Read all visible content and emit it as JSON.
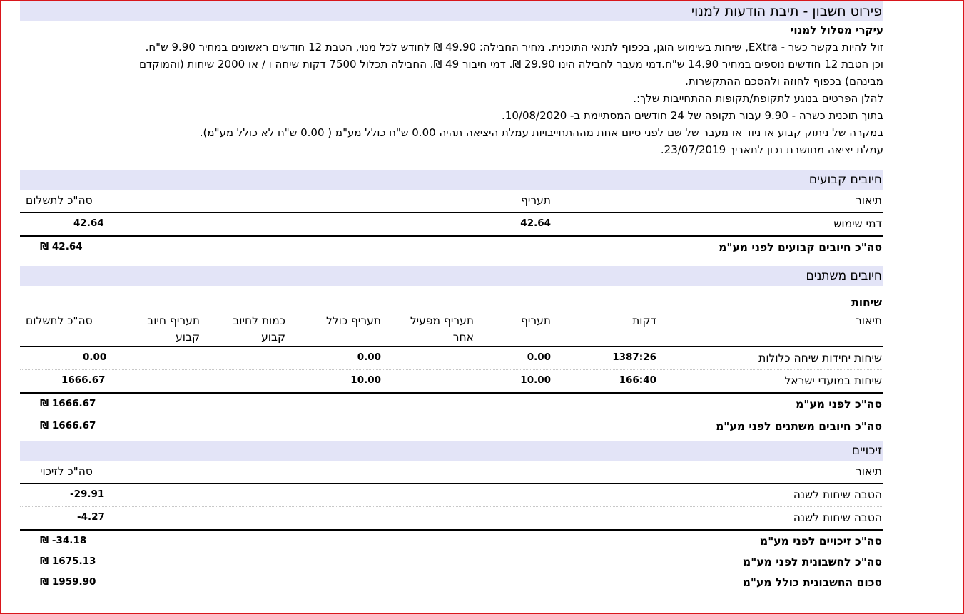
{
  "title": "פירוט חשבון - תיבת הודעות למנוי",
  "plan": {
    "heading": "עיקרי מסלול למנוי",
    "lines": [
      "זול להיות בקשר כשר - EXtra, שיחות בשימוש הוגן, בכפוף לתנאי התוכנית. מחיר החבילה: 49.90 ₪ לחודש לכל מנוי, הטבת 12 חודשים ראשונים במחיר 9.90 ש\"ח.",
      "וכן הטבת 12 חודשים נוספים במחיר 14.90 ש\"ח.דמי מעבר לחבילה הינו 29.90 ₪. דמי חיבור 49 ₪. החבילה תכלול 7500 דקות שיחה ו / או 2000 שיחות (והמוקדם",
      "מבינהם) בכפוף לחוזה ולהסכם ההתקשרות.",
      "להלן הפרטים בנוגע לתקופת/תקופות ההתחייבות שלך:.",
      "בתוך תוכנית כשרה - 9.90 עבור תקופה של 24 חודשים המסתיימת ב- 10/08/2020.",
      "במקרה של ניתוק קבוע או ניוד או מעבר של שם לפני סיום אחת מההתחייבויות עמלת היציאה תהיה 0.00 ש\"ח כולל מע\"מ ( 0.00 ש\"ח לא כולל מע\"מ).",
      "עמלת יציאה מחושבת נכון לתאריך 23/07/2019."
    ]
  },
  "fixed": {
    "band": "חיובים קבועים",
    "headers": {
      "desc": "תיאור",
      "rate": "תעריף",
      "total": "סה\"כ לתשלום"
    },
    "rows": [
      {
        "desc": "דמי שימוש",
        "rate": "42.64",
        "total": "42.64"
      }
    ],
    "total_label": "סה\"כ חיובים קבועים לפני מע\"מ",
    "total_value": "₪ 42.64"
  },
  "variable": {
    "band": "חיובים משתנים",
    "subheading": "שיחות",
    "headers": {
      "desc": "תיאור",
      "minutes": "דקות",
      "rate": "תעריף",
      "op_rate_1": "תעריף מפעיל",
      "op_rate_2": "אחר",
      "incl_rate": "תעריף כולל",
      "qty_1": "כמות לחיוב",
      "qty_2": "קבוע",
      "fix_rate_1": "תעריף חיוב",
      "fix_rate_2": "קבוע",
      "total": "סה\"כ לתשלום"
    },
    "rows": [
      {
        "desc": "שיחות יחידות שיחה כלולות",
        "minutes": "1387:26",
        "rate": "0.00",
        "incl_rate": "0.00",
        "total": "0.00"
      },
      {
        "desc": "שיחות במועדי ישראל",
        "minutes": "166:40",
        "rate": "10.00",
        "incl_rate": "10.00",
        "total": "1666.67"
      }
    ],
    "subtotal_label": "סה\"כ לפני מע\"מ",
    "subtotal_value": "₪ 1666.67",
    "total_label": "סה\"כ חיובים משתנים לפני מע\"מ",
    "total_value": "₪ 1666.67"
  },
  "credits": {
    "band": "זיכויים",
    "headers": {
      "desc": "תיאור",
      "total": "סה\"כ לזיכוי"
    },
    "rows": [
      {
        "desc": "הטבה שיחות לשנה",
        "total": "-29.91"
      },
      {
        "desc": "הטבה שיחות לשנה",
        "total": "-4.27"
      }
    ],
    "total_label": "סה\"כ זיכויים לפני מע\"מ",
    "total_value": "₪ -34.18"
  },
  "summary": {
    "account_label": "סה\"כ לחשבונית לפני מע\"מ",
    "account_value": "₪ 1675.13",
    "grand_label": "סכום החשבונית כולל מע\"מ",
    "grand_value": "₪ 1959.90"
  }
}
